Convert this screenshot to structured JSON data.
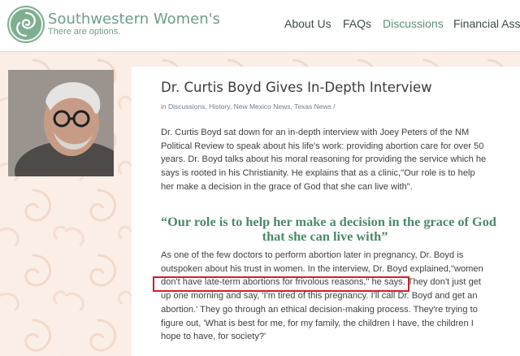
{
  "brand": {
    "title": "Southwestern Women's",
    "tagline": "There are options.",
    "colors": {
      "green": "#6f9e86",
      "peach": "#fbeee6"
    }
  },
  "nav": [
    {
      "label": "About Us"
    },
    {
      "label": "FAQs"
    },
    {
      "label": "Discussions",
      "active": true
    },
    {
      "label": "Financial Assis"
    }
  ],
  "post": {
    "title": "Dr. Curtis Boyd Gives In-Depth Interview",
    "meta_prefix": "in",
    "categories": "Discussions, History, New Mexico News, Texas News",
    "meta_suffix": "/",
    "paragraph1_lines": [
      "Dr. Curtis Boyd sat down for an in-depth interview with Joey Peters of the NM",
      "Political Review to speak about his life's work: providing abortion care for over 50",
      "years. Dr. Boyd talks about his moral reasoning for providing the service which he",
      "says is rooted in his Christianity. He explains that as a clinic,\"Our role is to help",
      "her make a decision in the grace of God that she can live with\"."
    ],
    "pull_quote_lines": [
      "“Our role is to help her make a decision in the grace of God",
      "that she can live with”"
    ],
    "paragraph2_lines": [
      "As one of the few doctors to perform abortion later in pregnancy, Dr. Boyd is",
      "outspoken about his trust in women. In the interview, Dr. Boyd explained,\"women",
      "don't have late-term abortions for frivolous reasons,\" he says. They don't just get",
      "up one morning and say, 'I'm tired of this pregnancy. I'll call Dr. Boyd and get an",
      "abortion.' They go through an ethical decision-making process. They're trying to",
      "figure out, 'What is best for me, for my family, the children I have, the children I",
      "hope to have, for society?'"
    ],
    "highlight_color": "#d21f26"
  }
}
